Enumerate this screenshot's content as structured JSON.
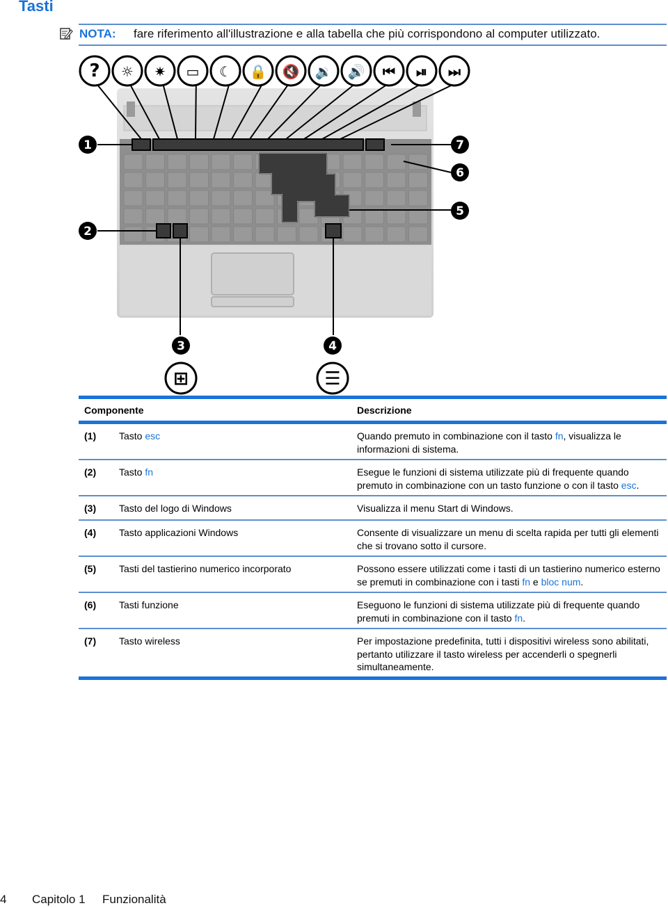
{
  "page": {
    "title": "Tasti",
    "note": {
      "label": "NOTA:",
      "text": "fare riferimento all'illustrazione e alla tabella che più corrispondono al computer utilizzato."
    },
    "figure": {
      "fn_icons": [
        "help-icon",
        "brightness-down-icon",
        "brightness-up-icon",
        "display-switch-icon",
        "sleep-icon",
        "lock-icon",
        "mute-icon",
        "volume-down-icon",
        "volume-up-icon",
        "previous-track-icon",
        "play-pause-icon",
        "next-track-icon"
      ],
      "callouts": [
        "1",
        "2",
        "3",
        "4",
        "5",
        "6",
        "7"
      ],
      "bottom_icons": [
        "windows-logo-icon",
        "applications-icon"
      ]
    },
    "table": {
      "headers": {
        "component": "Componente",
        "description": "Descrizione"
      },
      "rows": [
        {
          "num": "(1)",
          "comp_pre": "Tasto ",
          "comp_hl": "esc",
          "desc": [
            [
              "Quando premuto in combinazione con il tasto ",
              ""
            ],
            [
              "fn",
              "hl"
            ],
            [
              ", visualizza le informazioni di sistema.",
              ""
            ]
          ]
        },
        {
          "num": "(2)",
          "comp_pre": "Tasto ",
          "comp_hl": "fn",
          "desc": [
            [
              "Esegue le funzioni di sistema utilizzate più di frequente quando premuto in combinazione con un tasto funzione o con il tasto ",
              ""
            ],
            [
              "esc",
              "hl"
            ],
            [
              ".",
              ""
            ]
          ]
        },
        {
          "num": "(3)",
          "comp_pre": "Tasto del logo di Windows",
          "comp_hl": "",
          "desc": [
            [
              "Visualizza il menu Start di Windows.",
              ""
            ]
          ]
        },
        {
          "num": "(4)",
          "comp_pre": "Tasto applicazioni Windows",
          "comp_hl": "",
          "desc": [
            [
              "Consente di visualizzare un menu di scelta rapida per tutti gli elementi che si trovano sotto il cursore.",
              ""
            ]
          ]
        },
        {
          "num": "(5)",
          "comp_pre": "Tasti del tastierino numerico incorporato",
          "comp_hl": "",
          "desc": [
            [
              "Possono essere utilizzati come i tasti di un tastierino numerico esterno se premuti in combinazione con i tasti ",
              ""
            ],
            [
              "fn",
              "hl"
            ],
            [
              " e ",
              ""
            ],
            [
              "bloc num",
              "hl"
            ],
            [
              ".",
              ""
            ]
          ]
        },
        {
          "num": "(6)",
          "comp_pre": "Tasti funzione",
          "comp_hl": "",
          "desc": [
            [
              "Eseguono le funzioni di sistema utilizzate più di frequente quando premuti in combinazione con il tasto ",
              ""
            ],
            [
              "fn",
              "hl"
            ],
            [
              ".",
              ""
            ]
          ]
        },
        {
          "num": "(7)",
          "comp_pre": "Tasto wireless",
          "comp_hl": "",
          "desc": [
            [
              "Per impostazione predefinita, tutti i dispositivi wireless sono abilitati, pertanto utilizzare il tasto wireless per accenderli o spegnerli simultaneamente.",
              ""
            ]
          ]
        }
      ]
    },
    "footer": {
      "page_number": "4",
      "chapter": "Capitolo 1",
      "section": "Funzionalità"
    }
  },
  "colors": {
    "accent": "#1a73d9",
    "rule": "#5b8fd0"
  }
}
